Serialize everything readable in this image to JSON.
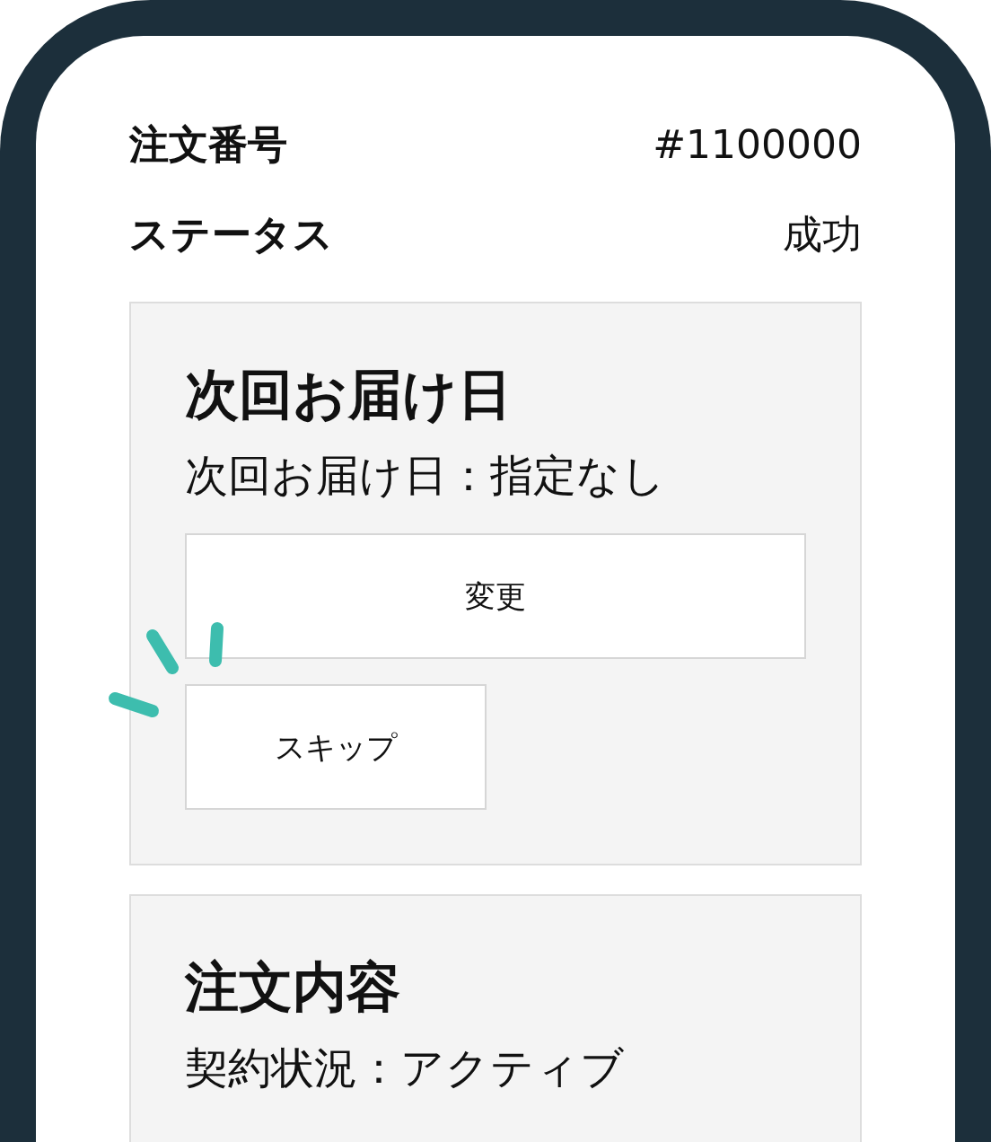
{
  "order_info": [
    {
      "label": "注文番号",
      "value": "#1100000"
    },
    {
      "label": "ステータス",
      "value": "成功"
    }
  ],
  "cards": [
    {
      "title": "次回お届け日",
      "text": "次回お届け日：指定なし",
      "buttons": [
        {
          "label": "変更",
          "kind": "wide"
        },
        {
          "label": "スキップ",
          "kind": "narrow"
        }
      ]
    },
    {
      "title": "注文内容",
      "text": "契約状況：アクティブ"
    }
  ]
}
